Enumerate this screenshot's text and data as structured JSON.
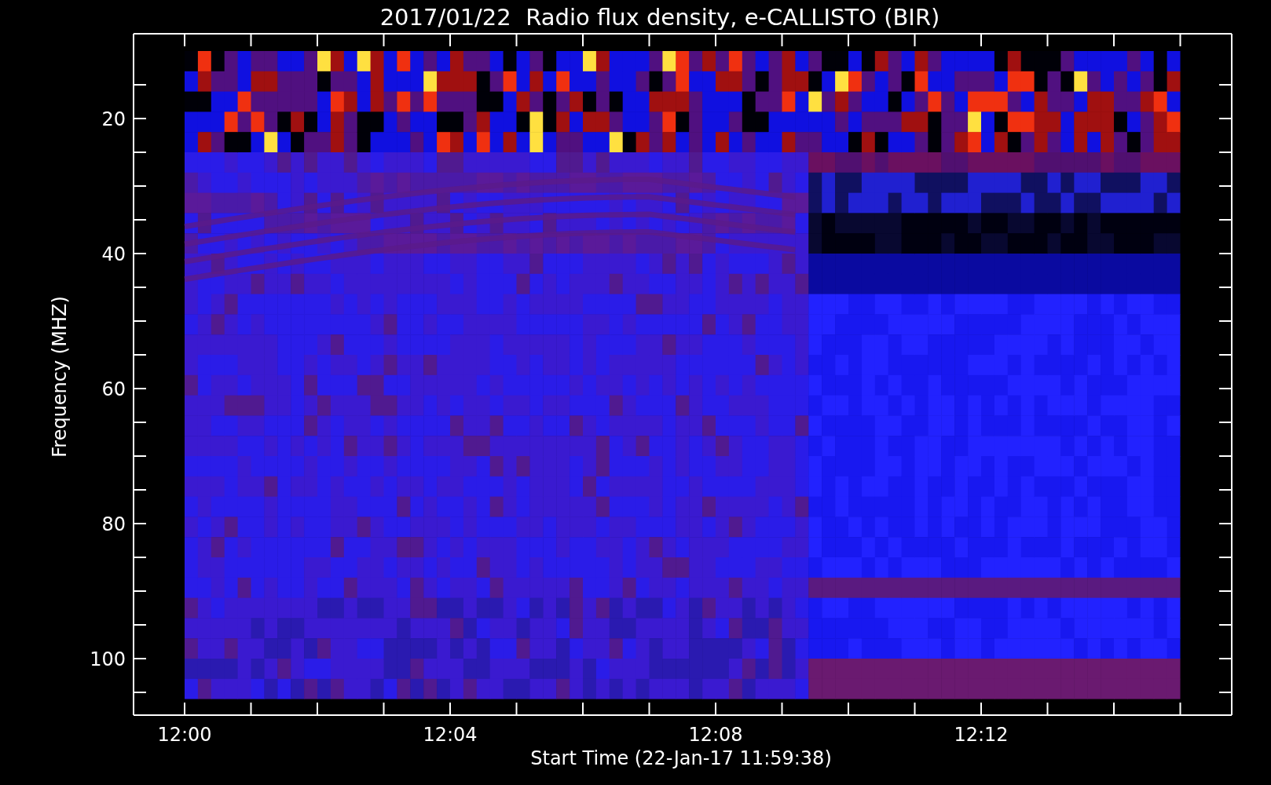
{
  "title": "2017/01/22  Radio flux density, e-CALLISTO (BIR)",
  "y_axis": {
    "label": "Frequency (MHZ)",
    "ticks": [
      "20",
      "40",
      "60",
      "80",
      "100"
    ]
  },
  "x_axis": {
    "label": "Start Time (22-Jan-17 11:59:38)",
    "ticks": [
      "12:00",
      "12:04",
      "12:08",
      "12:12"
    ]
  }
}
